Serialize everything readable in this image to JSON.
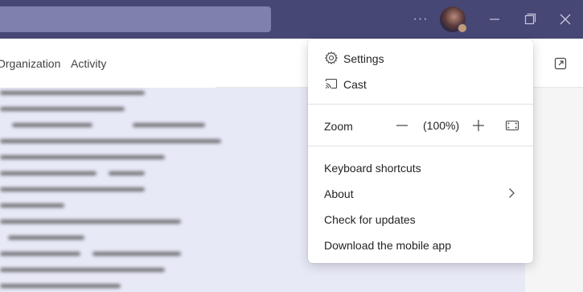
{
  "titlebar": {
    "more_label": "···",
    "icons": {
      "more": "more-horizontal-icon",
      "minimize": "minimize-icon",
      "maximize": "restore-icon",
      "close": "close-icon"
    }
  },
  "nav": {
    "tabs": [
      {
        "label": "Organization"
      },
      {
        "label": "Activity"
      }
    ]
  },
  "menu": {
    "settings_label": "Settings",
    "cast_label": "Cast",
    "zoom_label": "Zoom",
    "zoom_value": "(100%)",
    "keyboard_shortcuts_label": "Keyboard shortcuts",
    "about_label": "About",
    "check_updates_label": "Check for updates",
    "download_app_label": "Download the mobile app"
  },
  "colors": {
    "titlebar_bg": "#464775",
    "content_bg": "#e8e9f7"
  }
}
